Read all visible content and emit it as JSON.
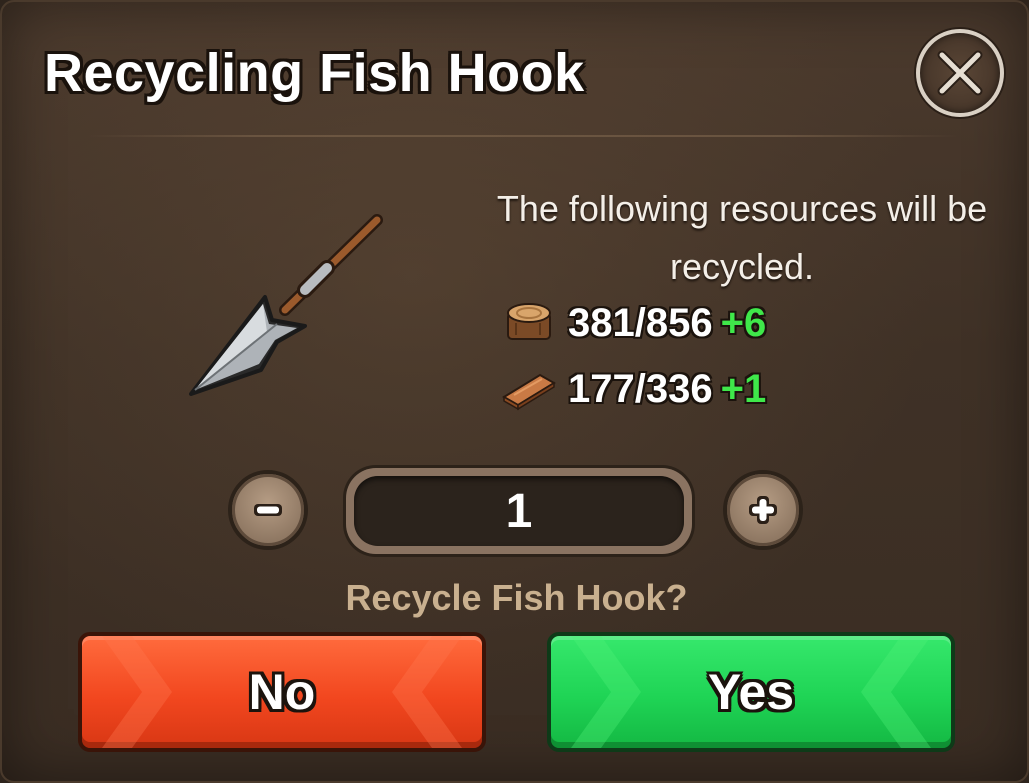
{
  "dialog": {
    "title": "Recycling Fish Hook",
    "close_icon": "close-icon",
    "description": "The following resources will be recycled.",
    "item_icon": "fish-hook-icon"
  },
  "resources": [
    {
      "icon": "wood-log-icon",
      "amount": "381/856",
      "gain": "+6"
    },
    {
      "icon": "wood-plank-icon",
      "amount": "177/336",
      "gain": "+1"
    }
  ],
  "quantity": {
    "value": "1",
    "minus_icon": "minus-icon",
    "plus_icon": "plus-icon"
  },
  "confirm": {
    "question": "Recycle Fish Hook?",
    "no_label": "No",
    "yes_label": "Yes"
  },
  "colors": {
    "no_button": "#f2471f",
    "yes_button": "#1fd455",
    "gain_text": "#3fe84a",
    "question_text": "#c9b08f"
  }
}
